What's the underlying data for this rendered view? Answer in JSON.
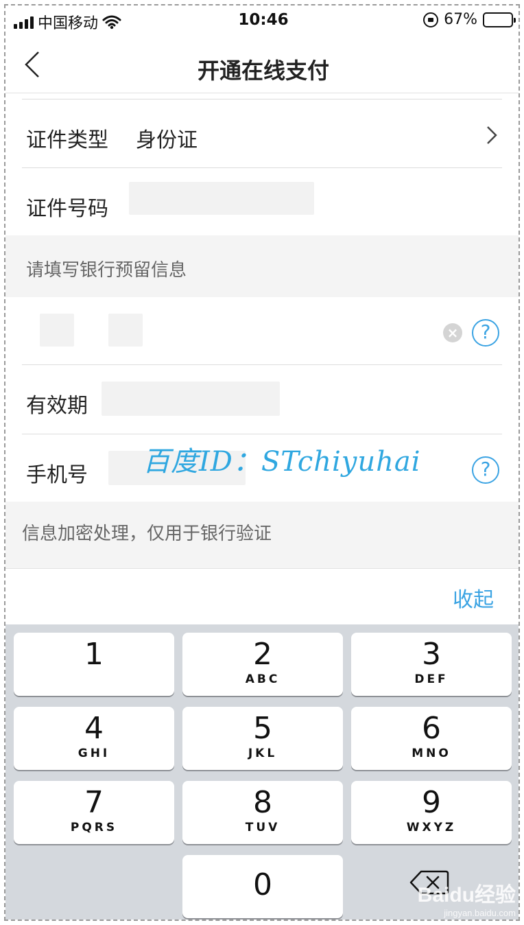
{
  "status_bar": {
    "carrier": "中国移动",
    "time": "10:46",
    "battery_text": "67%",
    "battery_level": 0.67,
    "icons": [
      "signal-icon",
      "wifi-icon",
      "rotation-lock-icon",
      "battery-icon"
    ]
  },
  "nav": {
    "title": "开通在线支付",
    "back_icon": "chevron-left-icon"
  },
  "form": {
    "id_type_label": "证件类型",
    "id_type_value": "身份证",
    "id_number_label": "证件号码",
    "section_bank_info": "请填写银行预留信息",
    "expiry_label": "有效期",
    "phone_label": "手机号",
    "section_note": "信息加密处理，仅用于银行验证",
    "help_symbol": "?",
    "clear_symbol": "×"
  },
  "watermark": "百度ID：STchiyuhai",
  "keyboard": {
    "collapse_label": "收起",
    "keys": [
      {
        "num": "1",
        "letters": ""
      },
      {
        "num": "2",
        "letters": "ABC"
      },
      {
        "num": "3",
        "letters": "DEF"
      },
      {
        "num": "4",
        "letters": "GHI"
      },
      {
        "num": "5",
        "letters": "JKL"
      },
      {
        "num": "6",
        "letters": "MNO"
      },
      {
        "num": "7",
        "letters": "PQRS"
      },
      {
        "num": "8",
        "letters": "TUV"
      },
      {
        "num": "9",
        "letters": "WXYZ"
      },
      {
        "num": "0",
        "letters": ""
      }
    ],
    "delete_icon": "backspace-icon"
  },
  "brand_mark": {
    "logo": "Baidu经验",
    "url": "jingyan.baidu.com"
  },
  "colors": {
    "accent": "#3aa3e3",
    "keyboard_bg": "#d4d8dd",
    "section_bg": "#f4f4f4"
  }
}
